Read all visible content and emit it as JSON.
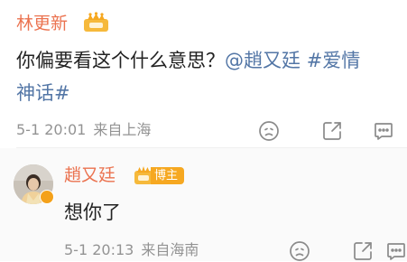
{
  "comment": {
    "author": "林更新",
    "text_part1": "你偏要看这个什么意思？",
    "mention": "@趙又廷",
    "topic_part1": "#爱情",
    "topic_part2": "神话#",
    "date": "5-1 20:01",
    "source": "来自上海",
    "actions": [
      "report-icon",
      "repost-icon",
      "reply-icon"
    ]
  },
  "reply": {
    "author": "趙又廷",
    "badge_label": "博主",
    "text": "想你了",
    "date": "5-1 20:13",
    "source": "来自海南",
    "actions": [
      "report-icon",
      "repost-icon",
      "reply-icon"
    ]
  },
  "colors": {
    "name": "#eb7350",
    "link": "#5376a6",
    "meta": "#939393",
    "badge": "#f6a821"
  }
}
